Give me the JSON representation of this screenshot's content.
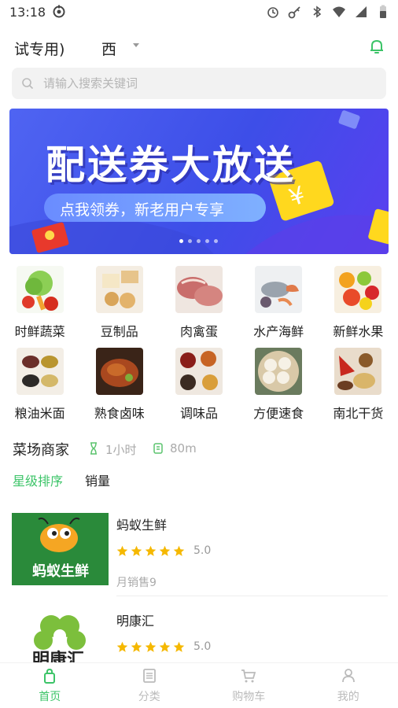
{
  "status_bar": {
    "time": "13:18"
  },
  "header": {
    "location_title": "试专用)",
    "location_city": "西"
  },
  "search": {
    "placeholder": "请输入搜索关键词"
  },
  "banner": {
    "title": "配送券大放送",
    "subtitle": "点我领券，新老用户专享",
    "active_dot": 0,
    "dot_count": 5
  },
  "categories": [
    {
      "label": "时鲜蔬菜",
      "icon": "vegetables-image"
    },
    {
      "label": "豆制品",
      "icon": "tofu-image"
    },
    {
      "label": "肉禽蛋",
      "icon": "meat-image"
    },
    {
      "label": "水产海鲜",
      "icon": "seafood-image"
    },
    {
      "label": "新鲜水果",
      "icon": "fruit-image"
    },
    {
      "label": "粮油米面",
      "icon": "grain-image"
    },
    {
      "label": "熟食卤味",
      "icon": "cooked-food-image"
    },
    {
      "label": "调味品",
      "icon": "seasoning-image"
    },
    {
      "label": "方便速食",
      "icon": "dumplings-image"
    },
    {
      "label": "南北干货",
      "icon": "dried-goods-image"
    }
  ],
  "section": {
    "title": "菜场商家",
    "time": "1小时",
    "distance": "80m"
  },
  "sort_tabs": [
    {
      "label": "星级排序",
      "active": true
    },
    {
      "label": "销量",
      "active": false
    }
  ],
  "shops": [
    {
      "name": "蚂蚁生鲜",
      "rating": "5.0",
      "stars": 5,
      "sales": "月销售9",
      "logo_text": "蚂蚁生鲜"
    },
    {
      "name": "明康汇",
      "rating": "5.0",
      "stars": 5,
      "sales": "",
      "logo_text": "明康汇"
    }
  ],
  "tab_bar": [
    {
      "label": "首页",
      "icon": "home-icon",
      "active": true
    },
    {
      "label": "分类",
      "icon": "category-icon",
      "active": false
    },
    {
      "label": "购物车",
      "icon": "cart-icon",
      "active": false
    },
    {
      "label": "我的",
      "icon": "profile-icon",
      "active": false
    }
  ],
  "colors": {
    "accent": "#3cc468",
    "star": "#f5b800",
    "banner": "#4a5cf0"
  }
}
